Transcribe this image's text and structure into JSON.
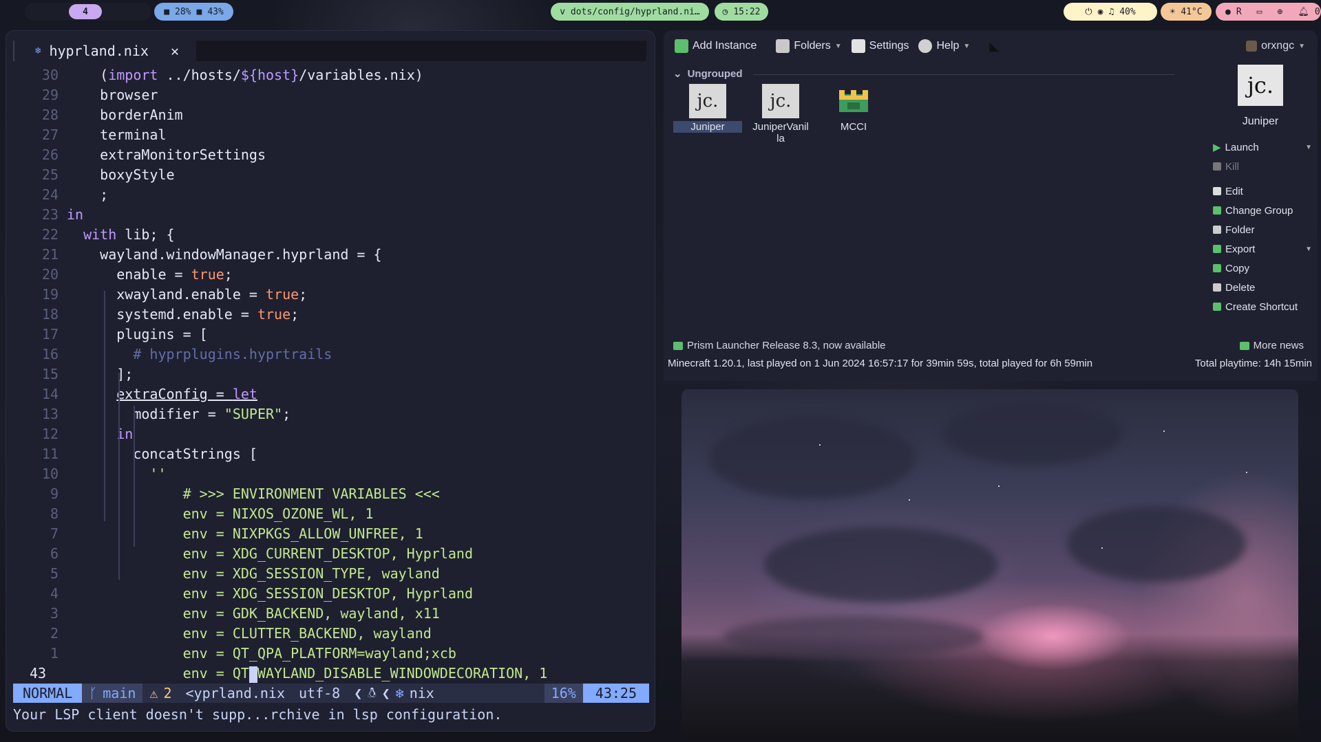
{
  "topbar": {
    "workspace": "4",
    "cpu": "28%",
    "mem": "43%",
    "window_title": "v dots/config/hyprland.ni…",
    "clock": "15:22",
    "volume": "40%",
    "temperature": "41°C",
    "right_label": "R",
    "notifications": "0"
  },
  "nvim": {
    "tab_name": "hyprland.nix",
    "tab_close": "✕",
    "lines": [
      {
        "n": "30",
        "t": "    (import ../hosts/${host}/variables.nix)"
      },
      {
        "n": "29",
        "t": "    browser"
      },
      {
        "n": "28",
        "t": "    borderAnim"
      },
      {
        "n": "27",
        "t": "    terminal"
      },
      {
        "n": "26",
        "t": "    extraMonitorSettings"
      },
      {
        "n": "25",
        "t": "    boxyStyle"
      },
      {
        "n": "24",
        "t": "    ;"
      },
      {
        "n": "23",
        "t": "in"
      },
      {
        "n": "22",
        "t": "  with lib; {"
      },
      {
        "n": "21",
        "t": "    wayland.windowManager.hyprland = {"
      },
      {
        "n": "20",
        "t": "      enable = true;"
      },
      {
        "n": "19",
        "t": "      xwayland.enable = true;"
      },
      {
        "n": "18",
        "t": "      systemd.enable = true;"
      },
      {
        "n": "17",
        "t": "      plugins = ["
      },
      {
        "n": "16",
        "t": "        # hyprplugins.hyprtrails"
      },
      {
        "n": "15",
        "t": "      ];"
      },
      {
        "n": "14",
        "t": "      extraConfig = let"
      },
      {
        "n": "13",
        "t": "        modifier = \"SUPER\";"
      },
      {
        "n": "12",
        "t": "      in"
      },
      {
        "n": "11",
        "t": "        concatStrings ["
      },
      {
        "n": "10",
        "t": "          ''"
      },
      {
        "n": "9",
        "t": "              # >>> ENVIRONMENT VARIABLES <<<"
      },
      {
        "n": "8",
        "t": "              env = NIXOS_OZONE_WL, 1"
      },
      {
        "n": "7",
        "t": "              env = NIXPKGS_ALLOW_UNFREE, 1"
      },
      {
        "n": "6",
        "t": "              env = XDG_CURRENT_DESKTOP, Hyprland"
      },
      {
        "n": "5",
        "t": "              env = XDG_SESSION_TYPE, wayland"
      },
      {
        "n": "4",
        "t": "              env = XDG_SESSION_DESKTOP, Hyprland"
      },
      {
        "n": "3",
        "t": "              env = GDK_BACKEND, wayland, x11"
      },
      {
        "n": "2",
        "t": "              env = CLUTTER_BACKEND, wayland"
      },
      {
        "n": "1",
        "t": "              env = QT_QPA_PLATFORM=wayland;xcb"
      }
    ],
    "current_line": {
      "n": "43",
      "before": "              env = QT",
      "after": "WAYLAND_DISABLE_WINDOWDECORATION, 1"
    },
    "status": {
      "mode": "NORMAL",
      "branch": "main",
      "warnings": "2",
      "file": "<yprland.nix",
      "encoding": "utf-8",
      "filetype": "nix",
      "percent": "16%",
      "position": "43:25"
    },
    "cmdline": "Your LSP client doesn't supp...rchive in lsp configuration."
  },
  "prism": {
    "toolbar": {
      "add_instance": "Add Instance",
      "folders": "Folders",
      "settings": "Settings",
      "help": "Help",
      "account": "orxngc"
    },
    "group": "Ungrouped",
    "instances": [
      {
        "name": "Juniper",
        "icon": "jc.",
        "selected": true
      },
      {
        "name": "JuniperVanilla",
        "label": "JuniperVanil\nla",
        "icon": "jc.",
        "selected": false
      },
      {
        "name": "MCCI",
        "icon": "",
        "selected": false
      }
    ],
    "side": {
      "selected_name": "Juniper",
      "icon": "jc.",
      "buttons": [
        "Launch",
        "Kill",
        "Edit",
        "Change Group",
        "Folder",
        "Export",
        "Copy",
        "Delete",
        "Create Shortcut"
      ]
    },
    "news": "Prism Launcher Release 8.3, now available",
    "more_news": "More news",
    "status_left": "Minecraft 1.20.1, last played on 1 Jun 2024 16:57:17 for 39min 59s, total played for 6h 59min",
    "status_right": "Total playtime: 14h 15min"
  }
}
